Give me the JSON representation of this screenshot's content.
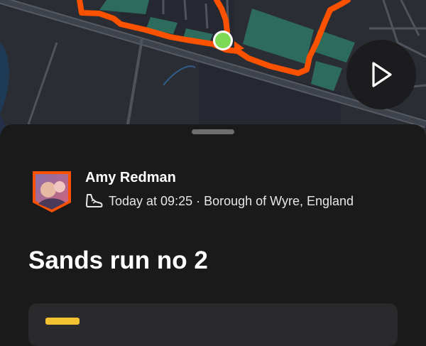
{
  "map": {
    "colors": {
      "background": "#2a2d33",
      "route": "#fc5200",
      "start_marker": "#7ed957",
      "parks": "#2d6b5d"
    },
    "play_icon": "play-icon"
  },
  "activity": {
    "athlete_name": "Amy Redman",
    "sport_icon": "shoe-icon",
    "meta": "Today at 09:25 · Borough of Wyre, England",
    "title": "Sands run no 2"
  }
}
